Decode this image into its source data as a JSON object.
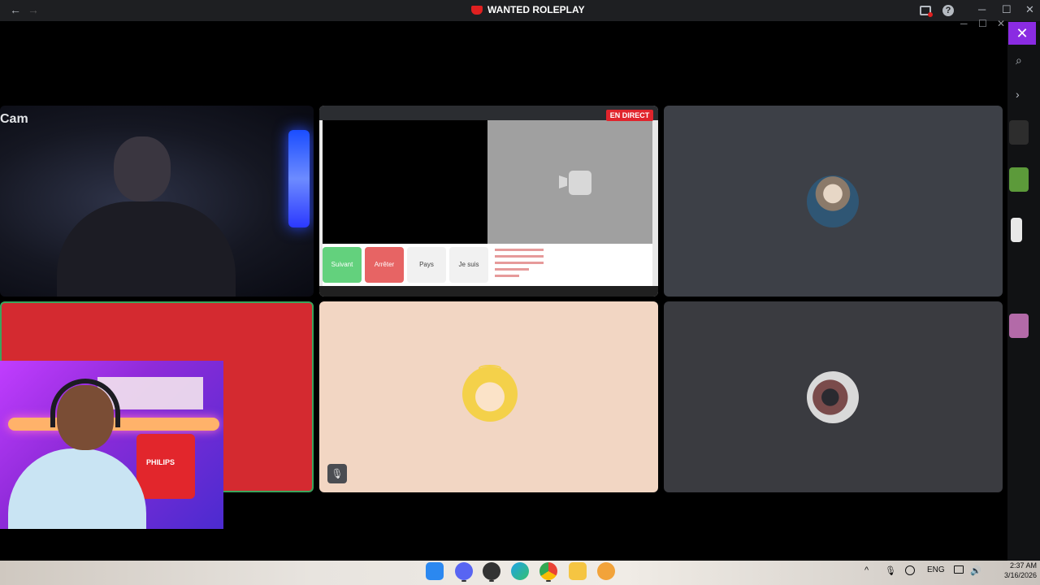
{
  "window": {
    "title": "WANTED ROLEPLAY",
    "back_icon": "arrow-left-icon",
    "forward_icon": "arrow-right-icon"
  },
  "titlebar_icons": [
    "inbox-icon",
    "help-icon"
  ],
  "window_controls": {
    "minimize": "─",
    "maximize": "☐",
    "close": "✕"
  },
  "side_panel": {
    "close_label": "✕",
    "search_icon": "search-icon",
    "expand_icon": "chevron-right-icon",
    "apps": [
      "gta-v-icon",
      "minecraft-icon",
      "bottle-icon",
      "pink-app-icon"
    ]
  },
  "tiles": {
    "cam_user": {
      "label": "Cam"
    },
    "screen_share": {
      "live_badge": "EN DIRECT",
      "buttons": {
        "next": "Suivant",
        "stop": "Arrêter",
        "country": "Pays",
        "i_am": "Je suis"
      }
    },
    "overlay_cam": {
      "jersey_text": "PHILIPS"
    }
  },
  "taskbar": {
    "apps": [
      "windows-start-icon",
      "discord-icon",
      "obs-icon",
      "edge-icon",
      "chrome-icon",
      "file-explorer-icon",
      "brave-icon"
    ],
    "tray": {
      "chevron": "^",
      "mic": "🎙",
      "language": "ENG",
      "volume": "🔊"
    },
    "time": "2:37 AM",
    "date": "3/16/2026"
  },
  "colors": {
    "discord_dark": "#1e1f22",
    "accent_purple": "#8a2be2",
    "live_red": "#e0242c",
    "speaking_green": "#3ba55d"
  }
}
